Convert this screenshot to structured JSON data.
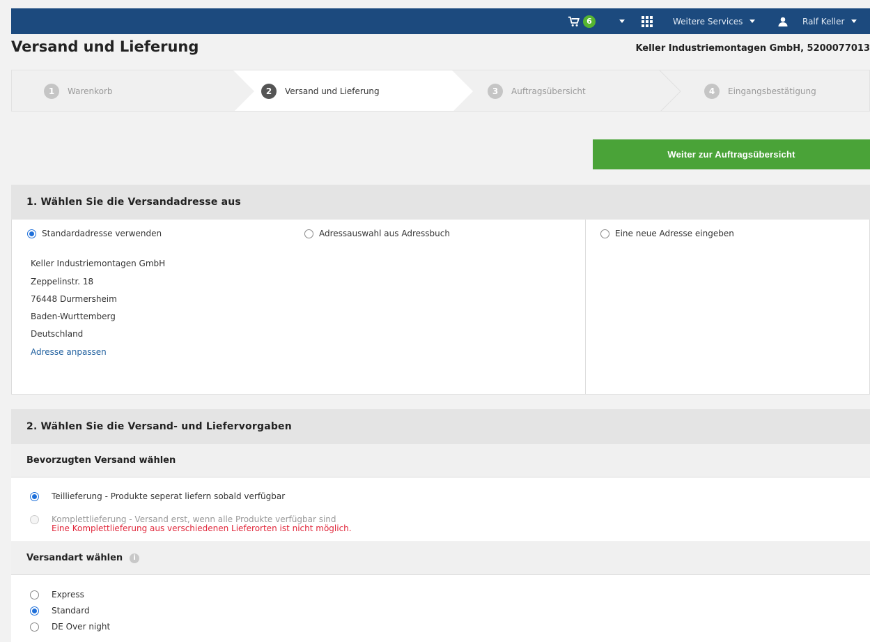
{
  "topbar": {
    "cart_count": "6",
    "services_label": "Weitere Services",
    "user_name": "Ralf Keller"
  },
  "header": {
    "title": "Versand und Lieferung",
    "account": "Keller Industriemontagen GmbH, 5200077013"
  },
  "steps": [
    {
      "num": "1",
      "label": "Warenkorb"
    },
    {
      "num": "2",
      "label": "Versand und Lieferung"
    },
    {
      "num": "3",
      "label": "Auftragsübersicht"
    },
    {
      "num": "4",
      "label": "Eingangsbestätigung"
    }
  ],
  "continue_label": "Weiter zur Auftragsübersicht",
  "section1": {
    "title": "1. Wählen Sie die Versandadresse aus",
    "options": [
      "Standardadresse verwenden",
      "Adressauswahl aus Adressbuch",
      "Eine neue Adresse eingeben"
    ],
    "address": {
      "company": "Keller Industriemontagen GmbH",
      "street": "Zeppelinstr. 18",
      "city": "76448 Durmersheim",
      "region": "Baden-Wurttemberg",
      "country": "Deutschland"
    },
    "edit_link": "Adresse anpassen"
  },
  "section2": {
    "title": "2. Wählen Sie die Versand- und Liefervorgaben",
    "preferred": {
      "heading": "Bevorzugten Versand wählen",
      "option_partial": "Teillieferung - Produkte seperat liefern sobald verfügbar",
      "option_complete": "Komplettlieferung - Versand erst, wenn alle Produkte verfügbar sind",
      "error": "Eine Komplettlieferung aus verschiedenen Lieferorten ist nicht möglich."
    },
    "shipping": {
      "heading": "Versandart wählen",
      "info_glyph": "i",
      "options": [
        "Express",
        "Standard",
        "DE Over night"
      ]
    }
  }
}
